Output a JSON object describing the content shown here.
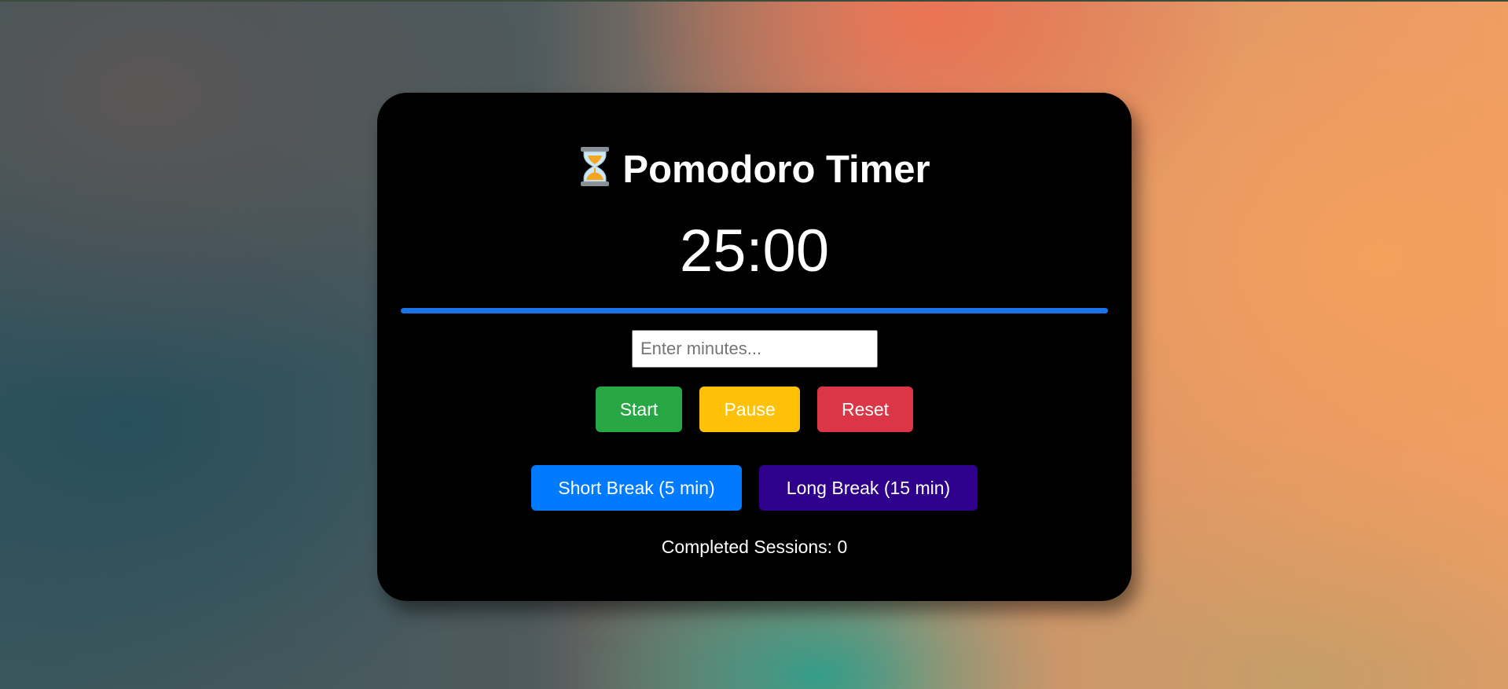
{
  "app": {
    "title": "Pomodoro Timer",
    "title_icon": "hourglass-icon"
  },
  "timer": {
    "display": "25:00",
    "progress_fraction": 1.0
  },
  "input": {
    "placeholder": "Enter minutes...",
    "value": ""
  },
  "controls": {
    "start_label": "Start",
    "pause_label": "Pause",
    "reset_label": "Reset"
  },
  "breaks": {
    "short_label": "Short Break (5 min)",
    "long_label": "Long Break (15 min)"
  },
  "stats": {
    "sessions_text": "Completed Sessions: 0"
  },
  "colors": {
    "card_background": "#000000",
    "progress": "#1a73e8",
    "start": "#28a745",
    "pause": "#ffc107",
    "reset": "#dc3545",
    "short_break": "#007bff",
    "long_break": "#2e008b"
  }
}
